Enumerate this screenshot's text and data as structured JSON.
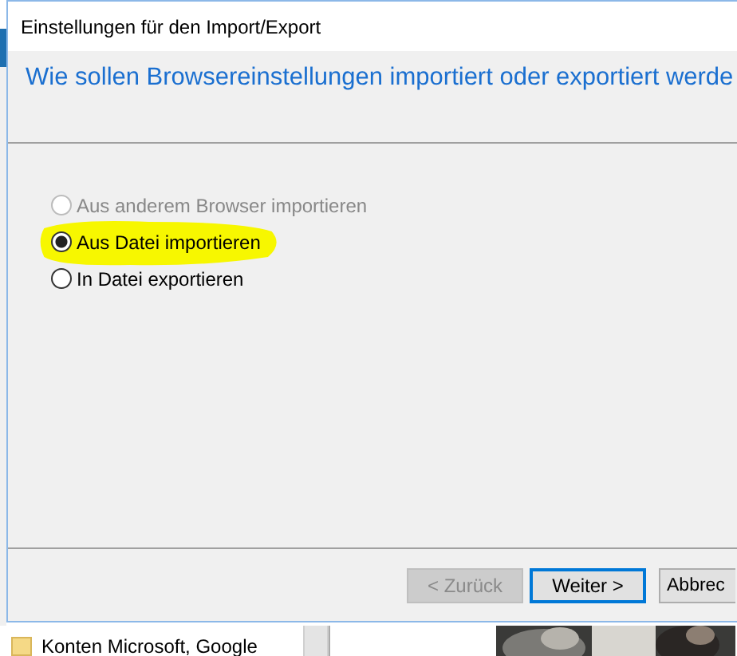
{
  "window": {
    "title": "Einstellungen für den Import/Export"
  },
  "heading": "Wie sollen Browsereinstellungen importiert oder exportiert werde",
  "options": [
    {
      "label": "Aus anderem Browser importieren",
      "selected": false,
      "disabled": true,
      "highlighted": false
    },
    {
      "label": "Aus Datei importieren",
      "selected": true,
      "disabled": false,
      "highlighted": true
    },
    {
      "label": "In Datei exportieren",
      "selected": false,
      "disabled": false,
      "highlighted": false
    }
  ],
  "buttons": [
    {
      "label": "< Zurück",
      "disabled": true,
      "default": false
    },
    {
      "label": "Weiter >",
      "disabled": false,
      "default": true
    },
    {
      "label": "Abbrec",
      "disabled": false,
      "default": false
    }
  ],
  "background_window": {
    "folder_label": "Konten Microsoft, Google"
  }
}
